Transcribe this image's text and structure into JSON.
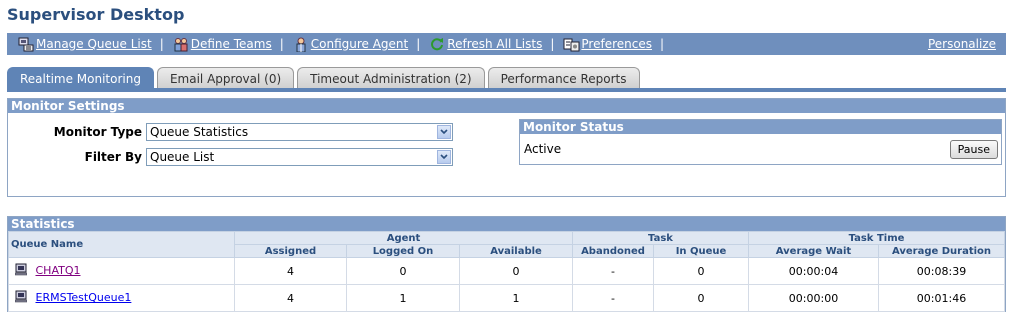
{
  "page": {
    "title": "Supervisor Desktop"
  },
  "toolbar": {
    "links": [
      {
        "label": "Manage Queue List",
        "icon": "queue-list-icon"
      },
      {
        "label": "Define Teams",
        "icon": "teams-icon"
      },
      {
        "label": "Configure Agent",
        "icon": "agent-icon"
      },
      {
        "label": "Refresh All Lists",
        "icon": "refresh-icon"
      },
      {
        "label": "Preferences",
        "icon": "preferences-icon"
      }
    ],
    "personalize": "Personalize",
    "bar_color": "#6f8fbd"
  },
  "tabs": [
    {
      "label": "Realtime Monitoring",
      "active": true
    },
    {
      "label": "Email Approval (0)",
      "active": false
    },
    {
      "label": "Timeout Administration (2)",
      "active": false
    },
    {
      "label": "Performance Reports",
      "active": false
    }
  ],
  "monitor_settings": {
    "title": "Monitor Settings",
    "monitor_type_label": "Monitor Type",
    "monitor_type_value": "Queue Statistics",
    "filter_by_label": "Filter By",
    "filter_by_value": "Queue List"
  },
  "monitor_status": {
    "title": "Monitor Status",
    "status": "Active",
    "pause_label": "Pause"
  },
  "statistics": {
    "title": "Statistics",
    "groups": {
      "queue_name": "Queue Name",
      "agent": "Agent",
      "task": "Task",
      "task_time": "Task Time"
    },
    "columns": [
      "Assigned",
      "Logged On",
      "Available",
      "Abandoned",
      "In Queue",
      "Average Wait",
      "Average Duration"
    ],
    "rows": [
      {
        "name": "CHATQ1",
        "visited": true,
        "values": [
          "4",
          "0",
          "0",
          "-",
          "0",
          "00:00:04",
          "00:08:39"
        ]
      },
      {
        "name": "ERMSTestQueue1",
        "visited": false,
        "values": [
          "4",
          "1",
          "1",
          "-",
          "0",
          "00:00:00",
          "00:01:46"
        ]
      }
    ]
  },
  "colors": {
    "title": "#2b4f7e",
    "header_blue": "#7f9dc8",
    "active_tab": "#5f84b6",
    "visited_link": "#800080",
    "link": "#0000ee"
  }
}
